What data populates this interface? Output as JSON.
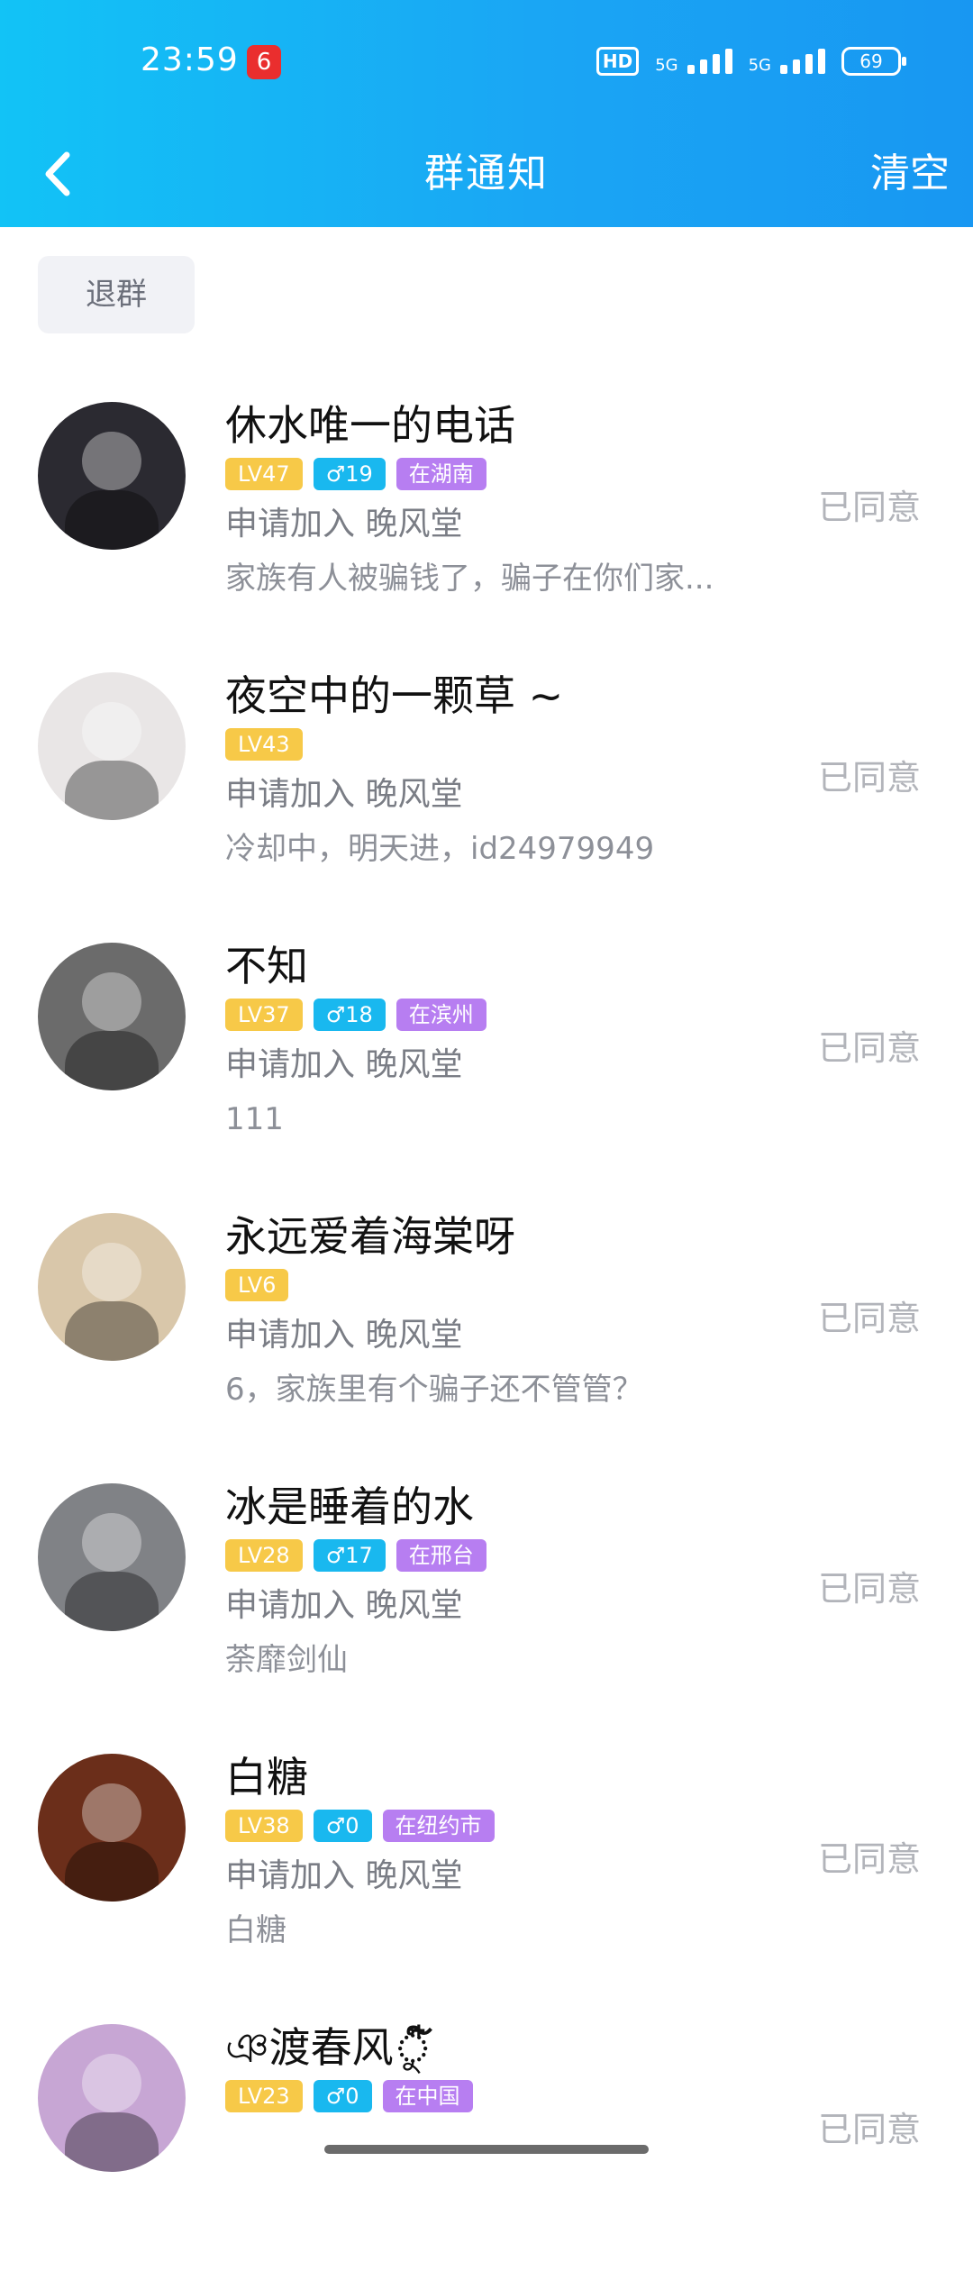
{
  "status_bar": {
    "time": "23:59",
    "app_badge": "6",
    "hd": "HD",
    "signal1_label": "5G",
    "signal2_label": "5G",
    "battery": "69"
  },
  "header": {
    "title": "群通知",
    "clear": "清空",
    "back_icon": "chevron-left"
  },
  "actions": {
    "quit": "退群"
  },
  "notices": [
    {
      "name": "休水唯一的电话",
      "lv": "LV47",
      "sex": "♂19",
      "loc": "在湖南",
      "line1": "申请加入 晚风堂",
      "line2": "家族有人被骗钱了，骗子在你们家...",
      "status": "已同意",
      "avatar_color": "#2b2a31"
    },
    {
      "name": "夜空中的一颗草 ~",
      "lv": "LV43",
      "sex": "",
      "loc": "",
      "line1": "申请加入 晚风堂",
      "line2": "冷却中，明天进，id24979949",
      "status": "已同意",
      "avatar_color": "#e9e6e6"
    },
    {
      "name": "不知",
      "lv": "LV37",
      "sex": "♂18",
      "loc": "在滨州",
      "line1": "申请加入 晚风堂",
      "line2": "111",
      "status": "已同意",
      "avatar_color": "#6b6b6b"
    },
    {
      "name": "永远爱着海棠呀",
      "lv": "LV6",
      "sex": "",
      "loc": "",
      "line1": "申请加入 晚风堂",
      "line2": "6，家族里有个骗子还不管管？",
      "status": "已同意",
      "avatar_color": "#d9c7aa"
    },
    {
      "name": "冰是睡着的水",
      "lv": "LV28",
      "sex": "♂17",
      "loc": "在邢台",
      "line1": "申请加入 晚风堂",
      "line2": "荼靡剑仙",
      "status": "已同意",
      "avatar_color": "#808286"
    },
    {
      "name": "白糖",
      "lv": "LV38",
      "sex": "♂0",
      "loc": "在纽约市",
      "line1": "申请加入 晚风堂",
      "line2": "白糖",
      "status": "已同意",
      "avatar_color": "#6b2e1a"
    },
    {
      "name": "ঞ渡春风ু໌໋",
      "lv": "LV23",
      "sex": "♂0",
      "loc": "在中国",
      "line1": "",
      "line2": "",
      "status": "已同意",
      "avatar_color": "#c7a6d4"
    }
  ]
}
